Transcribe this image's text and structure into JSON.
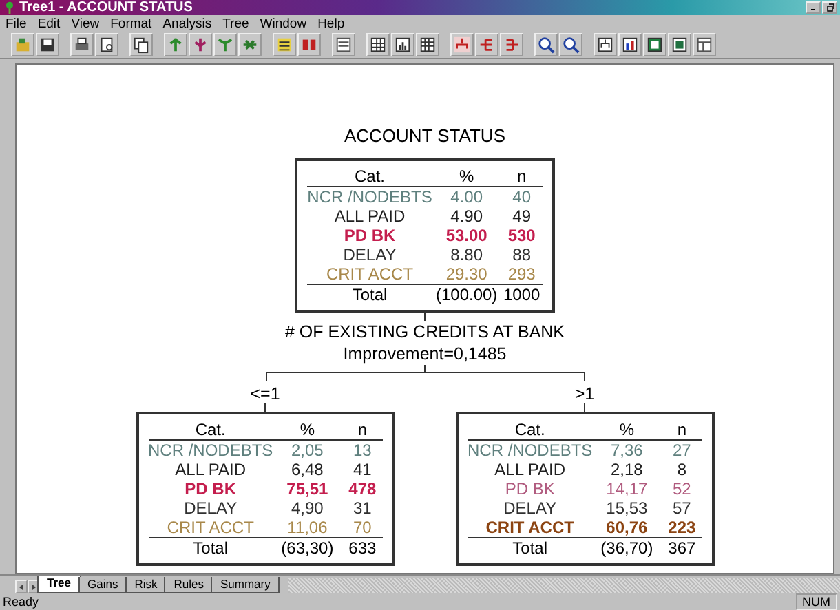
{
  "window": {
    "title": "Tree1 - ACCOUNT STATUS"
  },
  "menu": [
    "File",
    "Edit",
    "View",
    "Format",
    "Analysis",
    "Tree",
    "Window",
    "Help"
  ],
  "tree": {
    "title": "ACCOUNT STATUS",
    "root": {
      "columns": [
        "Cat.",
        "%",
        "n"
      ],
      "rows": [
        {
          "cat": "NCR /NODEBTS",
          "pct": "4.00",
          "n": "40",
          "color": "#5f807e",
          "bold": false
        },
        {
          "cat": "ALL PAID",
          "pct": "4.90",
          "n": "49",
          "color": "#202020",
          "bold": false
        },
        {
          "cat": "PD BK",
          "pct": "53.00",
          "n": "530",
          "color": "#c41e4e",
          "bold": true
        },
        {
          "cat": "DELAY",
          "pct": "8.80",
          "n": "88",
          "color": "#303030",
          "bold": false
        },
        {
          "cat": "CRIT ACCT",
          "pct": "29.30",
          "n": "293",
          "color": "#a8884a",
          "bold": false
        }
      ],
      "total": {
        "label": "Total",
        "pct": "(100.00)",
        "n": "1000"
      }
    },
    "split": {
      "variable": "# OF EXISTING CREDITS AT BANK",
      "improvement": "Improvement=0,1485"
    },
    "children": [
      {
        "branch": "<=1",
        "node": {
          "columns": [
            "Cat.",
            "%",
            "n"
          ],
          "rows": [
            {
              "cat": "NCR /NODEBTS",
              "pct": "2,05",
              "n": "13",
              "color": "#5f807e",
              "bold": false
            },
            {
              "cat": "ALL PAID",
              "pct": "6,48",
              "n": "41",
              "color": "#202020",
              "bold": false
            },
            {
              "cat": "PD BK",
              "pct": "75,51",
              "n": "478",
              "color": "#c41e4e",
              "bold": true
            },
            {
              "cat": "DELAY",
              "pct": "4,90",
              "n": "31",
              "color": "#303030",
              "bold": false
            },
            {
              "cat": "CRIT ACCT",
              "pct": "11,06",
              "n": "70",
              "color": "#a8884a",
              "bold": false
            }
          ],
          "total": {
            "label": "Total",
            "pct": "(63,30)",
            "n": "633"
          }
        }
      },
      {
        "branch": ">1",
        "node": {
          "columns": [
            "Cat.",
            "%",
            "n"
          ],
          "rows": [
            {
              "cat": "NCR /NODEBTS",
              "pct": "7,36",
              "n": "27",
              "color": "#5f807e",
              "bold": false
            },
            {
              "cat": "ALL PAID",
              "pct": "2,18",
              "n": "8",
              "color": "#202020",
              "bold": false
            },
            {
              "cat": "PD BK",
              "pct": "14,17",
              "n": "52",
              "color": "#b05a7e",
              "bold": false
            },
            {
              "cat": "DELAY",
              "pct": "15,53",
              "n": "57",
              "color": "#303030",
              "bold": false
            },
            {
              "cat": "CRIT ACCT",
              "pct": "60,76",
              "n": "223",
              "color": "#8c4412",
              "bold": true
            }
          ],
          "total": {
            "label": "Total",
            "pct": "(36,70)",
            "n": "367"
          }
        }
      }
    ]
  },
  "tabs": [
    {
      "label": "Tree",
      "selected": true
    },
    {
      "label": "Gains",
      "selected": false
    },
    {
      "label": "Risk",
      "selected": false
    },
    {
      "label": "Rules",
      "selected": false
    },
    {
      "label": "Summary",
      "selected": false
    }
  ],
  "status_bar": {
    "message": "Ready",
    "indicator": "NUM"
  }
}
